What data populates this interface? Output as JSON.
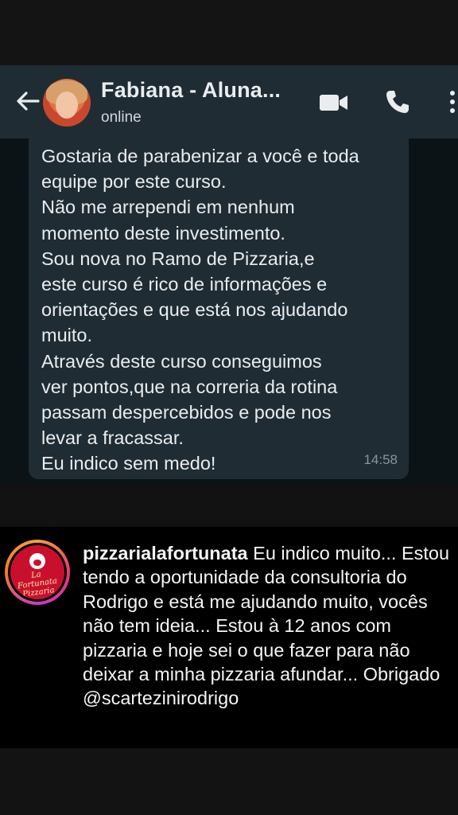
{
  "whatsapp": {
    "contact_name": "Fabiana - Aluna...",
    "status": "online",
    "message": "Gostaria de parabenizar a você e toda\nequipe por este curso.\nNão me arrependi em nenhum\nmomento deste investimento.\nSou nova no Ramo de Pizzaria,e\neste curso é rico de informações e\norientações e que está nos ajudando\nmuito.\nAtravés deste curso conseguimos\nver pontos,que na correria da rotina\npassam  despercebidos e pode nos\nlevar a fracassar.\nEu indico sem medo!",
    "time": "14:58",
    "icons": [
      "back-arrow-icon",
      "video-call-icon",
      "phone-icon",
      "more-vertical-icon"
    ],
    "colors": {
      "header": "#1f2c34",
      "bubble": "#202c33",
      "background": "#0c1317"
    }
  },
  "instagram_comment": {
    "username": "pizzarialafortunata",
    "text": " Eu indico muito... Estou tendo a oportunidade da consultoria do Rodrigo e está me ajudando muito, vocês não tem ideia... Estou à 12 anos com pizzaria e hoje sei o que fazer para não deixar a minha pizzaria afundar... Obrigado @scartezinirodrigo",
    "avatar_logo_text": "La Fortunata Pizzaria"
  }
}
